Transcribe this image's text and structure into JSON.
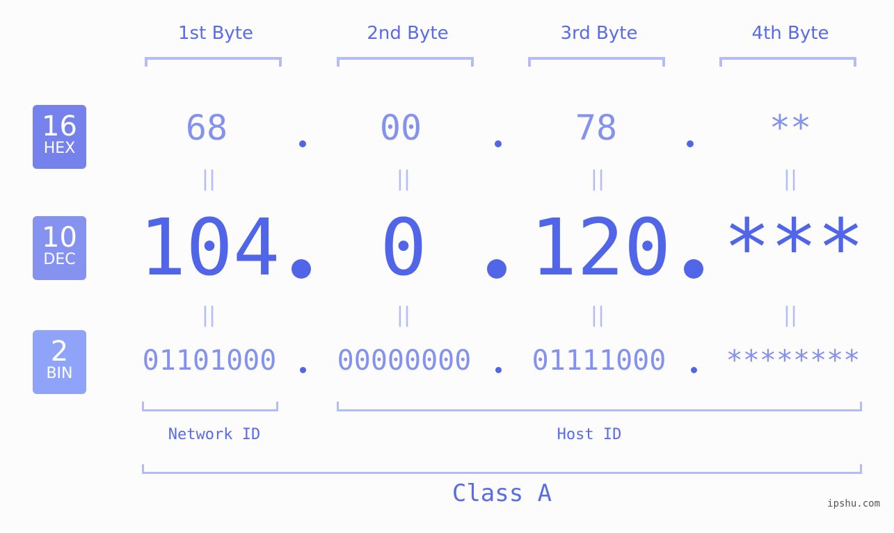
{
  "bytes": [
    {
      "header": "1st Byte",
      "hex": "68",
      "dec": "104",
      "bin": "01101000"
    },
    {
      "header": "2nd Byte",
      "hex": "00",
      "dec": "0",
      "bin": "00000000"
    },
    {
      "header": "3rd Byte",
      "hex": "78",
      "dec": "120",
      "bin": "01111000"
    },
    {
      "header": "4th Byte",
      "hex": "**",
      "dec": "***",
      "bin": "********"
    }
  ],
  "bases": [
    {
      "num": "16",
      "label": "HEX",
      "color": "#7582ec"
    },
    {
      "num": "10",
      "label": "DEC",
      "color": "#8592f0"
    },
    {
      "num": "2",
      "label": "BIN",
      "color": "#8fa4f8"
    }
  ],
  "equals_symbol": "||",
  "network_id_label": "Network ID",
  "host_id_label": "Host ID",
  "class_label": "Class A",
  "footer": "ipshu.com",
  "colors": {
    "accent": "#5065e8",
    "light": "#8592ed",
    "bracket": "#b3bcf7"
  }
}
